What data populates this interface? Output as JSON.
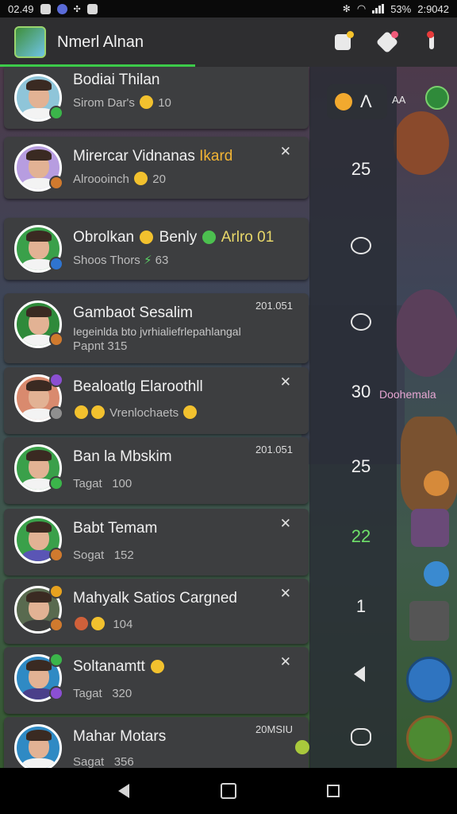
{
  "status_bar": {
    "time_left": "02.49",
    "battery": "53%",
    "time_right": "2:9042"
  },
  "header": {
    "title": "Nmerl Alnan"
  },
  "chats": [
    {
      "name": "Bodiai Thilan",
      "sub": "Sirom Dar's",
      "count": "10"
    },
    {
      "name_a": "Mirercar Vidnanas",
      "name_b": "Ikard",
      "sub": "Alroooinch",
      "count": "20"
    },
    {
      "name": "Obrolkan",
      "name_tail": "Benly",
      "name_tail2": "Arlro",
      "name_tail3": "01",
      "sub": "Shoos Thors",
      "count": "63"
    },
    {
      "name": "Gambaot Sesalim",
      "line2": "Iegeinlda bto jvrhialiefrlepahlangal",
      "sub": "Papnt 315",
      "time": "201.051"
    },
    {
      "name": "Bealoatlg Elaroothll",
      "sub": "Vrenlochaets"
    },
    {
      "name": "Ban la Mbskim",
      "sub": "Tagat",
      "count": "100",
      "time": "201.051"
    },
    {
      "name": "Babt Temam",
      "sub": "Sogat",
      "count": "152"
    },
    {
      "name": "Mahyalk Satios Cargned",
      "count": "104"
    },
    {
      "name": "Soltanamtt",
      "sub": "Tagat",
      "count": "320"
    },
    {
      "name": "Mahar Motars",
      "sub": "Sagat",
      "count": "356",
      "time": "20MSIU"
    }
  ],
  "side": {
    "tag_text": "Ʌ",
    "n1": "25",
    "n2": "30",
    "n3": "25",
    "n4": "22",
    "n5": "1",
    "overlay_label": "Doohemala",
    "top_label": "AA"
  },
  "colors": {
    "accent": "#3dcc4a",
    "card": "#3d3e40",
    "header": "#2e2e30"
  }
}
